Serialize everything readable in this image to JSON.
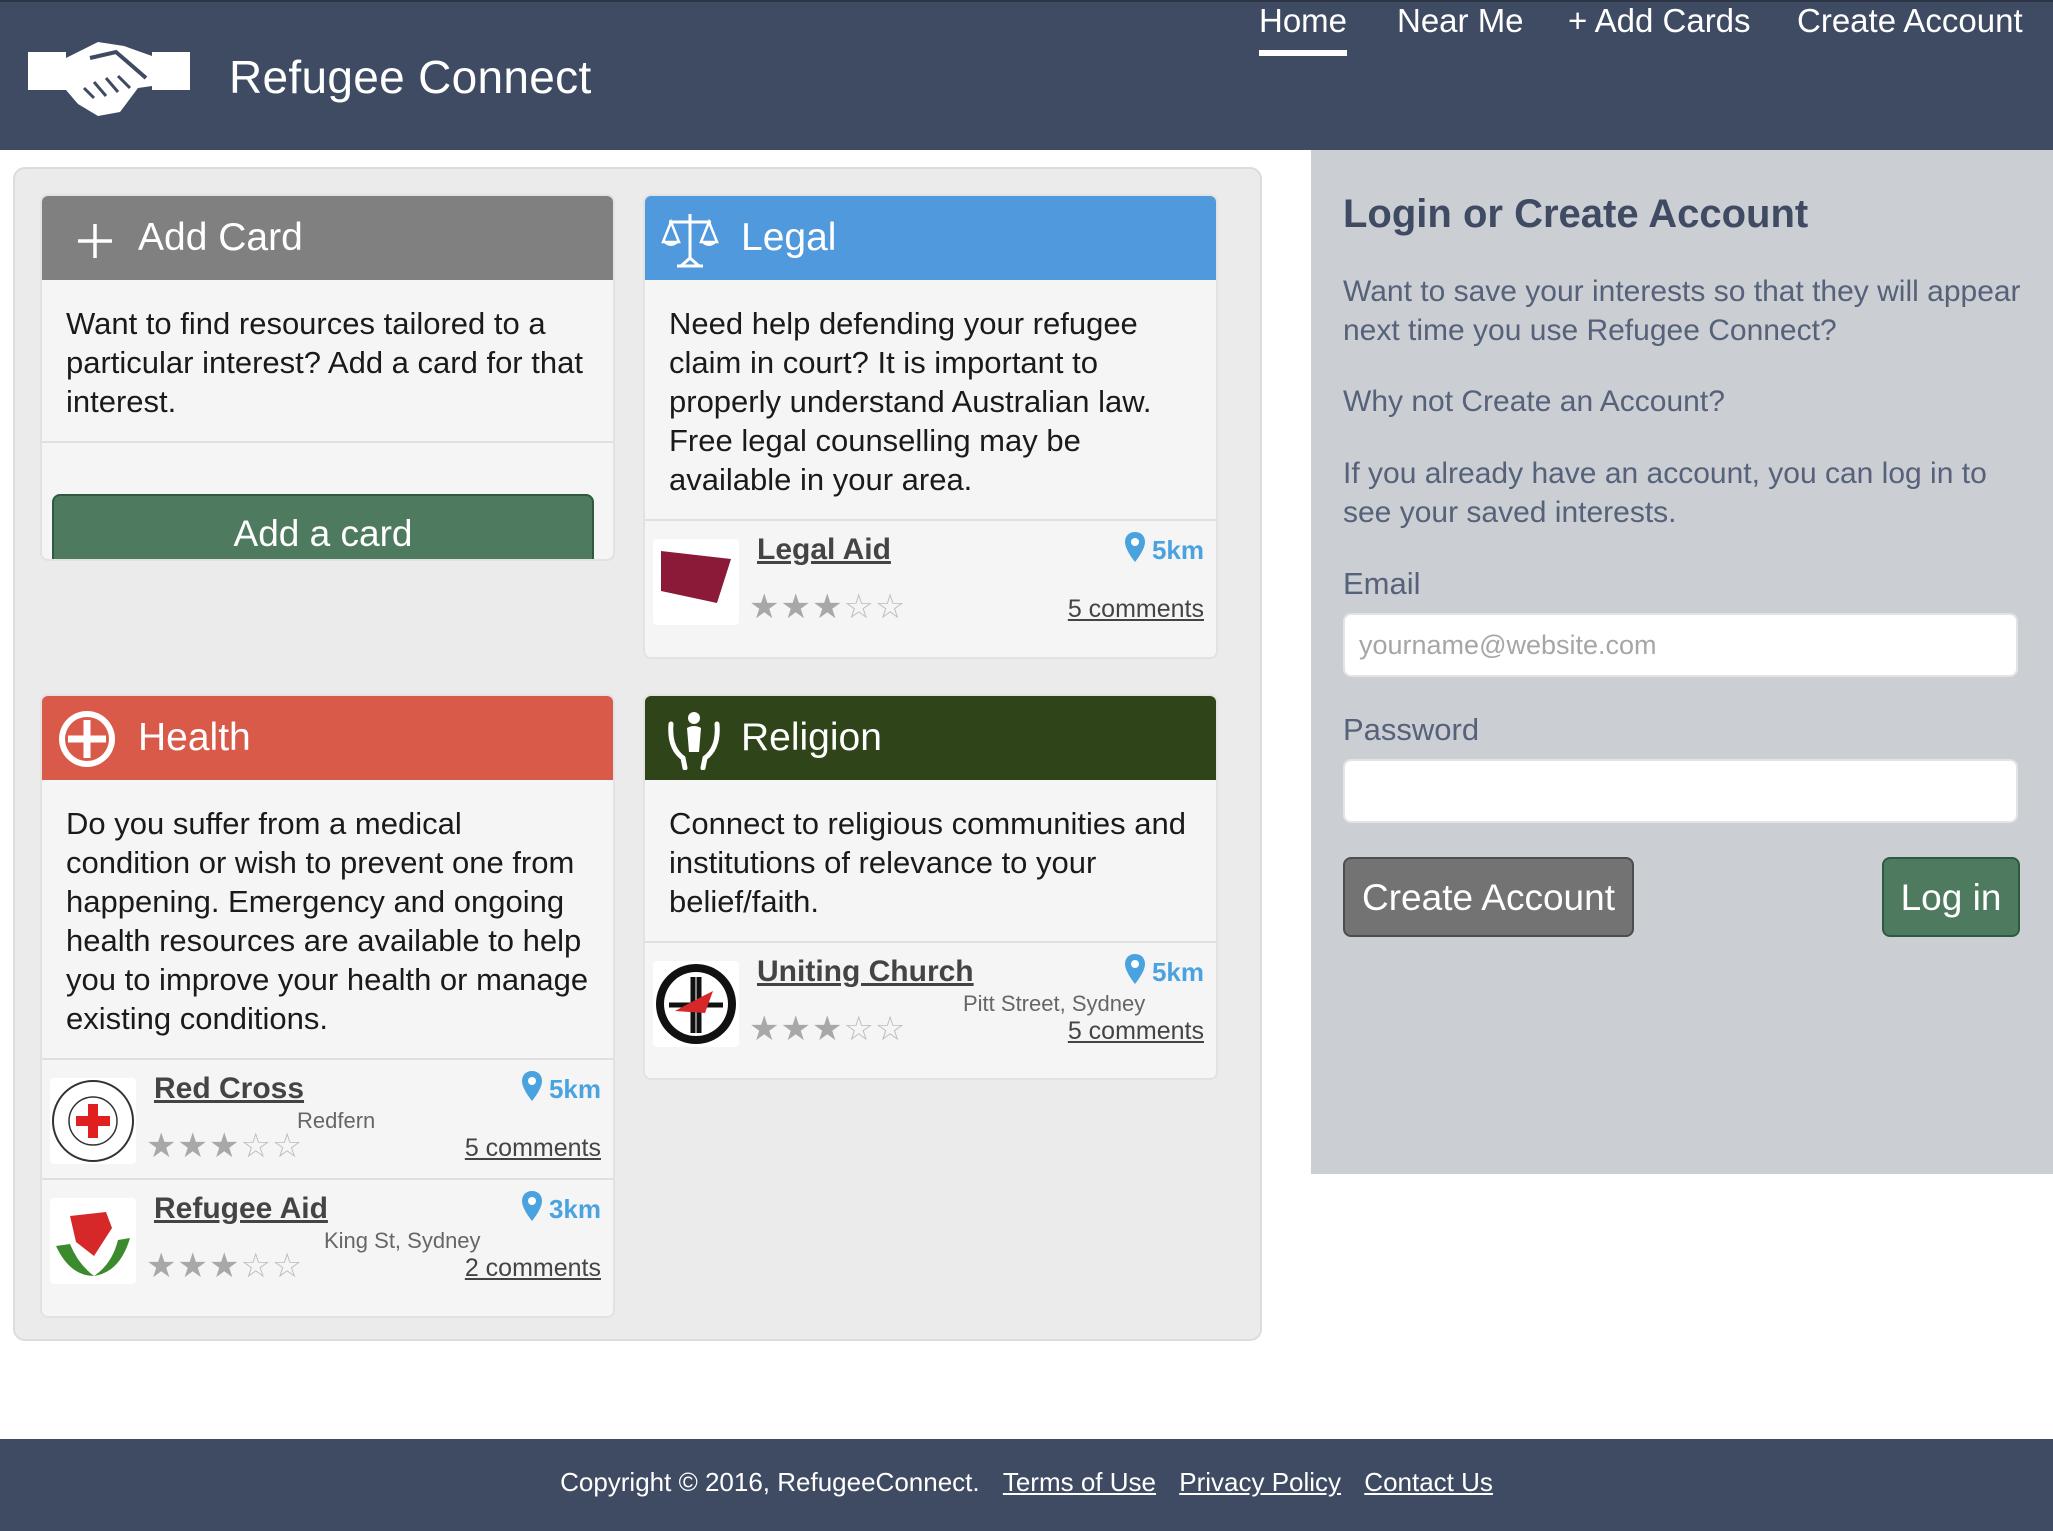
{
  "header": {
    "site_title": "Refugee Connect",
    "logo_icon": "handshake-icon",
    "nav": [
      {
        "label": "Home",
        "active": true
      },
      {
        "label": "Near Me",
        "active": false
      },
      {
        "label": "+ Add Cards",
        "active": false
      },
      {
        "label": "Create Account",
        "active": false
      }
    ]
  },
  "colors": {
    "header_bg": "#3f4b62",
    "add_card_header": "#808080",
    "legal_header": "#5099dc",
    "health_header": "#d95a48",
    "religion_header": "#2f4519",
    "accent_green": "#4e7a60",
    "distance_blue": "#4aa3df",
    "sidebar_bg": "#cbced3"
  },
  "cards": {
    "add_card": {
      "title": "Add Card",
      "icon": "plus-icon",
      "description": "Want to find resources tailored to a particular interest? Add a card for that interest.",
      "button_label": "Add a card"
    },
    "legal": {
      "title": "Legal",
      "icon": "scales-of-justice-icon",
      "description": "Need help defending your refugee claim in court? It is important to properly understand Australian law. Free legal counselling may be available in your area.",
      "resources": [
        {
          "name": "Legal Aid",
          "location": "",
          "distance": "5km",
          "rating": 3,
          "max_rating": 5,
          "comments": "5 comments",
          "thumb": "legal-aid-logo"
        }
      ]
    },
    "health": {
      "title": "Health",
      "icon": "medical-cross-icon",
      "description": "Do you suffer from a medical condition or wish to prevent one from happening. Emergency and ongoing health resources are available to help you to improve your health or manage existing conditions.",
      "resources": [
        {
          "name": "Red Cross",
          "location": "Redfern",
          "distance": "5km",
          "rating": 3,
          "max_rating": 5,
          "comments": "5 comments",
          "thumb": "australian-red-cross-logo"
        },
        {
          "name": "Refugee Aid",
          "location": "King St, Sydney",
          "distance": "3km",
          "rating": 3,
          "max_rating": 5,
          "comments": "2 comments",
          "thumb": "refugee-aid-logo"
        }
      ]
    },
    "religion": {
      "title": "Religion",
      "icon": "praying-hands-icon",
      "description": "Connect to religious communities and institutions of relevance to your belief/faith.",
      "resources": [
        {
          "name": "Uniting Church",
          "location": "Pitt Street, Sydney",
          "distance": "5km",
          "rating": 3,
          "max_rating": 5,
          "comments": "5 comments",
          "thumb": "uniting-church-logo"
        }
      ]
    }
  },
  "login": {
    "title": "Login or Create Account",
    "intro": "Want to save your interests so that they will appear next time you use Refugee Connect?",
    "prompt": "Why not Create an Account?",
    "existing": "If you already have an account, you can log in to see your saved interests.",
    "email_label": "Email",
    "email_placeholder": "yourname@website.com",
    "email_value": "",
    "password_label": "Password",
    "password_value": "",
    "create_button": "Create Account",
    "login_button": "Log in"
  },
  "footer": {
    "copyright": "Copyright © 2016, RefugeeConnect.",
    "links": [
      "Terms of Use",
      "Privacy Policy",
      "Contact Us"
    ]
  }
}
